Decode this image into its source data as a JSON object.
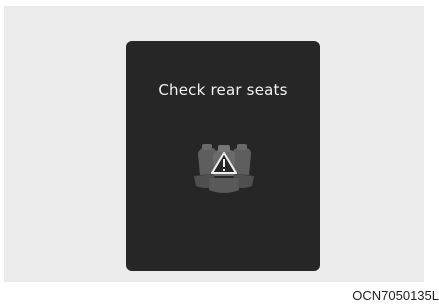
{
  "display": {
    "message": "Check rear seats",
    "icon": "rear-seats-warning-icon"
  },
  "caption": "OCN7050135L",
  "colors": {
    "screen": "#262626",
    "text": "#f2f2f2",
    "seat": "#5a5a5a",
    "backdrop": "#ebebeb"
  }
}
